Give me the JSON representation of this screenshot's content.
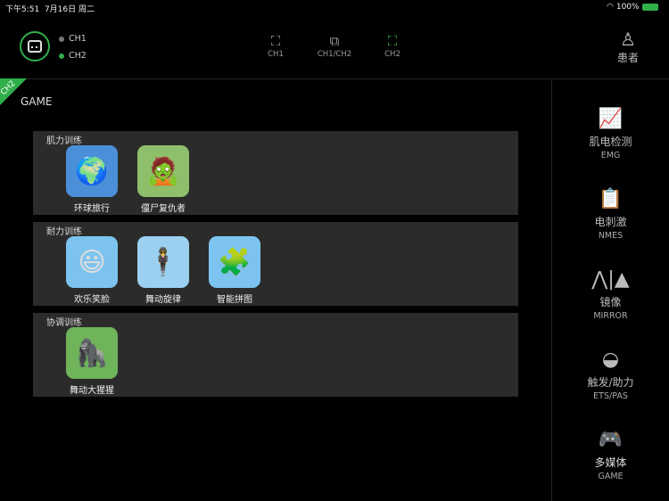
{
  "status": {
    "time": "下午5:51",
    "date": "7月16日 周二",
    "battery": "100%"
  },
  "channels": [
    {
      "label": "CH1",
      "color": "#777777"
    },
    {
      "label": "CH2",
      "color": "#2fae4a"
    }
  ],
  "modes": [
    {
      "label": "CH1"
    },
    {
      "label": "CH1/CH2"
    },
    {
      "label": "CH2"
    }
  ],
  "patient": {
    "label": "患者"
  },
  "corner_badge": "CH2",
  "section_title": "GAME",
  "groups": [
    {
      "title": "肌力训练",
      "apps": [
        {
          "label": "环球旅行",
          "glyph": "🌍",
          "bg": "#4a8fd8"
        },
        {
          "label": "僵尸复仇者",
          "glyph": "🧟",
          "bg": "#8fbf6a"
        }
      ]
    },
    {
      "title": "耐力训练",
      "apps": [
        {
          "label": "欢乐笑脸",
          "glyph": "😃",
          "bg": "#7cc4ef"
        },
        {
          "label": "舞动旋律",
          "glyph": "🕴",
          "bg": "#9bd0f0"
        },
        {
          "label": "智能拼图",
          "glyph": "🧩",
          "bg": "#7cc4ef"
        }
      ]
    },
    {
      "title": "协调训练",
      "apps": [
        {
          "label": "舞动大猩猩",
          "glyph": "🦍",
          "bg": "#6fb35a"
        }
      ]
    }
  ],
  "sidebar": [
    {
      "cn": "肌电检测",
      "en": "EMG",
      "glyph": "📈"
    },
    {
      "cn": "电刺激",
      "en": "NMES",
      "glyph": "📋"
    },
    {
      "cn": "镜像",
      "en": "MIRROR",
      "glyph": "⋀|▲"
    },
    {
      "cn": "触发/助力",
      "en": "ETS/PAS",
      "glyph": "◒"
    },
    {
      "cn": "多媒体",
      "en": "GAME",
      "glyph": "🎮"
    }
  ]
}
